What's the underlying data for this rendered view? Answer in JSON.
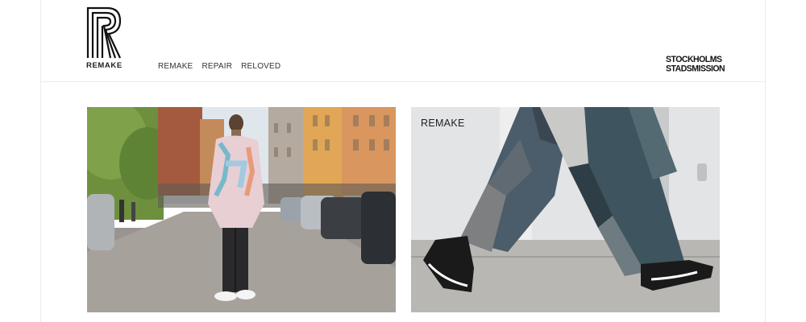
{
  "brand": {
    "logo_letter": "R",
    "logo_text": "REMAKE"
  },
  "nav": {
    "items": [
      "REMAKE",
      "REPAIR",
      "RELOVED"
    ]
  },
  "partner": {
    "line1": "STOCKHOLMS",
    "line2": "STADSMISSION"
  },
  "cards": [
    {
      "label": "",
      "image": "street-photo-man-colorful-jacket"
    },
    {
      "label": "REMAKE",
      "image": "patchwork-jeans-walking-photo"
    }
  ]
}
